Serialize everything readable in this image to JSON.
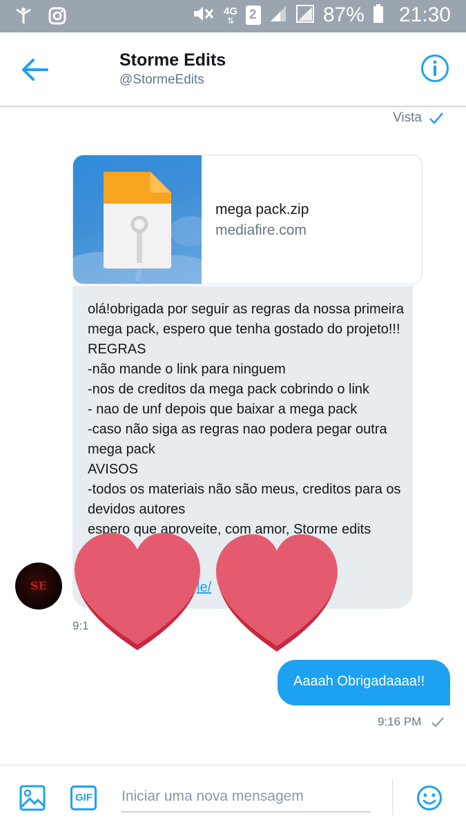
{
  "status_bar": {
    "battery": "87%",
    "time": "21:30",
    "network": "4G",
    "sim": "2"
  },
  "header": {
    "title": "Storme Edits",
    "handle": "@StormeEdits"
  },
  "seen_label": "Vista",
  "link_card": {
    "file_name": "mega pack.zip",
    "domain": "mediafire.com"
  },
  "received_message": {
    "text": "olá!obrigada por seguir as regras da nossa primeira mega pack, espero que tenha gostado do projeto!!!\nREGRAS\n-não mande o link para ninguem\n-nos de creditos da mega pack cobrindo o link\n- nao de unf depois que baixar a mega pack\n-caso não siga as regras nao podera pegar outra mega pack\nAVISOS\n-todos os materiais não são meus, creditos para os devidos autores\nespero que aproveite, com amor, Storme edits",
    "link_fragment": "le/",
    "time": "9:1"
  },
  "avatar": {
    "initials": "SE"
  },
  "sent_message": {
    "text": "Aaaah Obrigadaaaa!!",
    "time": "9:16 PM"
  },
  "composer": {
    "placeholder": "Iniciar uma nova mensagem",
    "gif_label": "GIF"
  },
  "colors": {
    "accent": "#1da1f2",
    "bubble_received": "#e6ecf0",
    "heart": "#e45b6f"
  }
}
